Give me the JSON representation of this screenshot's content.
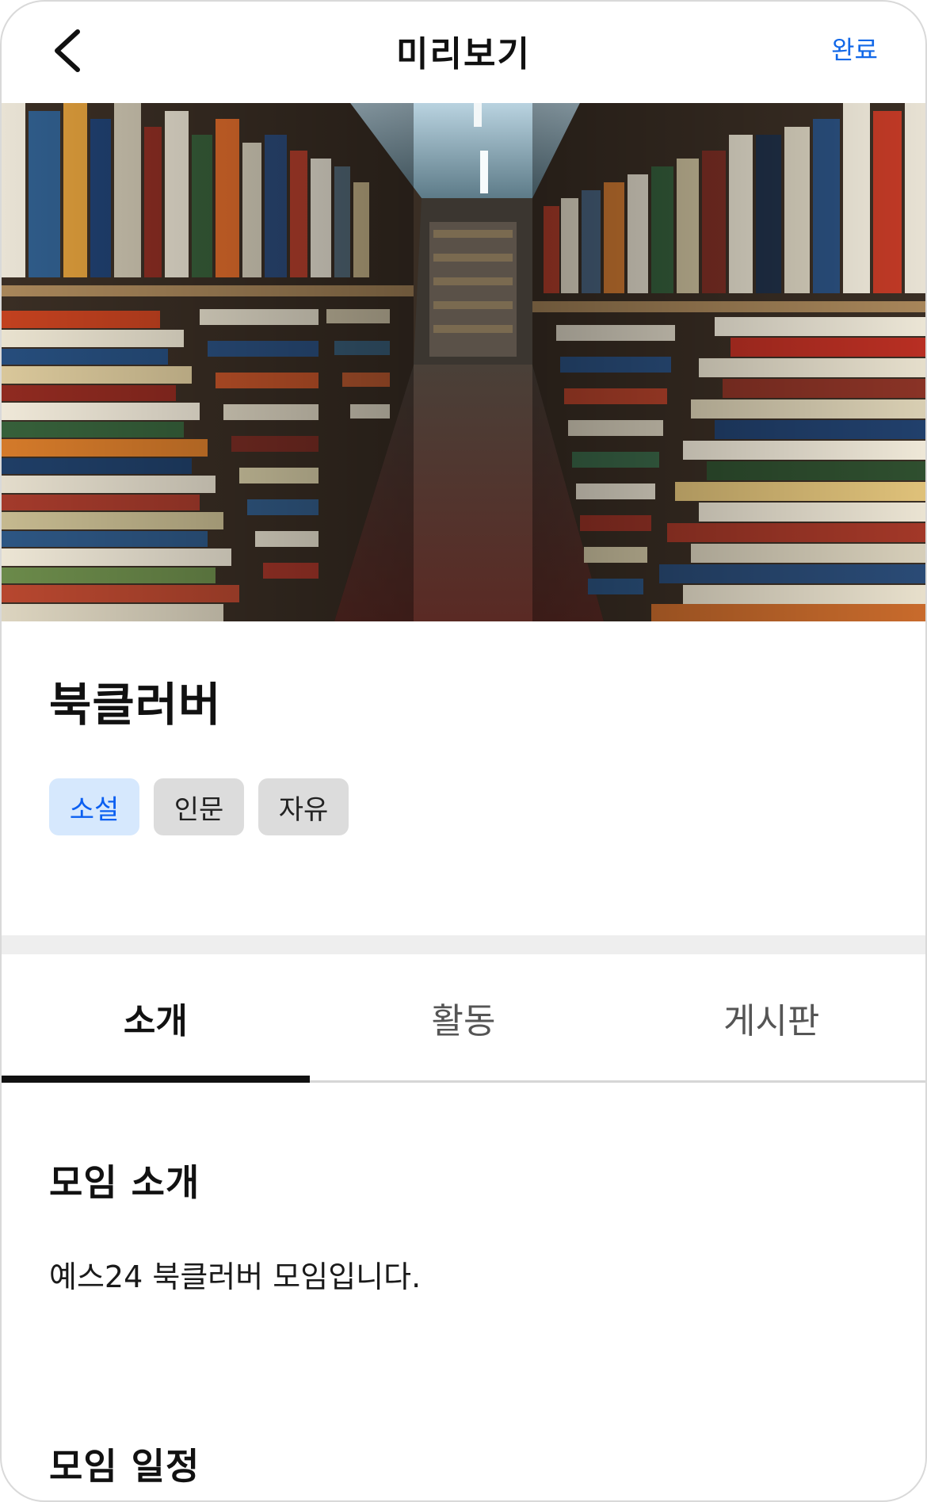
{
  "header": {
    "title": "미리보기",
    "done_label": "완료"
  },
  "club": {
    "name": "북클러버",
    "tags": [
      {
        "label": "소설",
        "selected": true
      },
      {
        "label": "인문",
        "selected": false
      },
      {
        "label": "자유",
        "selected": false
      }
    ]
  },
  "tabs": [
    {
      "label": "소개",
      "active": true
    },
    {
      "label": "활동",
      "active": false
    },
    {
      "label": "게시판",
      "active": false
    }
  ],
  "content": {
    "intro_title": "모임 소개",
    "intro_text": "예스24 북클러버 모임입니다.",
    "schedule_title": "모임 일정"
  },
  "colors": {
    "accent": "#1268e8",
    "tag_selected_bg": "#d6e8fd",
    "tag_selected_text": "#0b5ff1",
    "tag_bg": "#dcdcdc"
  },
  "icons": {
    "back": "chevron-left-icon"
  }
}
